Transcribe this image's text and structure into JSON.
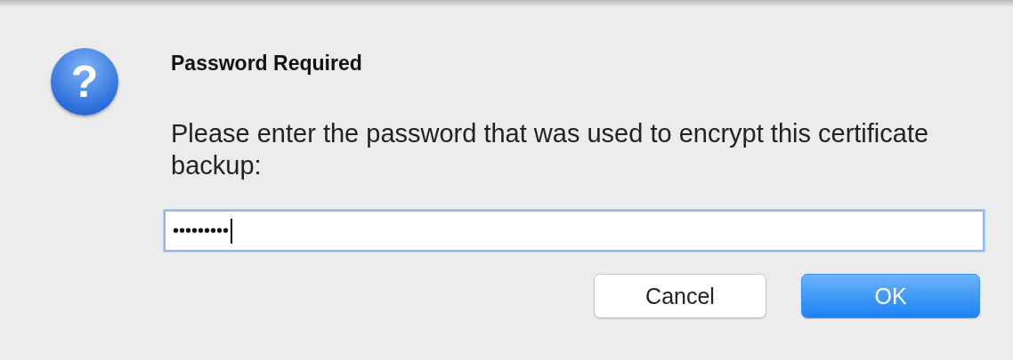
{
  "dialog": {
    "icon_glyph": "?",
    "title": "Password Required",
    "message": "Please enter the password that was used to encrypt this certificate backup:",
    "password_field": {
      "value": "•••••••••",
      "focused": true
    },
    "buttons": [
      {
        "label": "Cancel",
        "default": false
      },
      {
        "label": "OK",
        "default": true
      }
    ]
  }
}
